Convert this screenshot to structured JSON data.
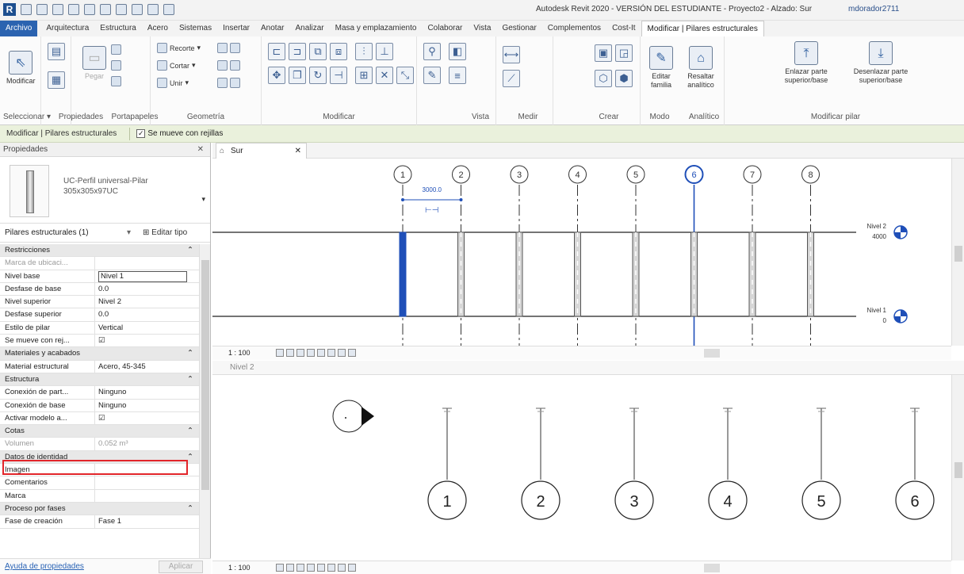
{
  "window_title": "Autodesk Revit 2020 - VERSIÓN DEL ESTUDIANTE - Proyecto2 - Alzado: Sur",
  "user": "mdorador2711",
  "tabs": [
    "Archivo",
    "Arquitectura",
    "Estructura",
    "Acero",
    "Sistemas",
    "Insertar",
    "Anotar",
    "Analizar",
    "Masa y emplazamiento",
    "Colaborar",
    "Vista",
    "Gestionar",
    "Complementos",
    "Cost-It",
    "Modificar | Pilares estructurales"
  ],
  "ribbon": {
    "modificar_label": "Modificar",
    "pegar_label": "Pegar",
    "recorte_label": "Recorte",
    "cortar_label": "Cortar",
    "unir_label": "Unir",
    "editar_familia_label": "Editar familia",
    "resaltar_analitico_label": "Resaltar analítico",
    "enlazar_label": "Enlazar parte superior/base",
    "desenlazar_label": "Desenlazar parte superior/base",
    "panels": {
      "seleccionar": "Seleccionar ▾",
      "propiedades": "Propiedades",
      "portapapeles": "Portapapeles",
      "geometria": "Geometría",
      "modificar": "Modificar",
      "vista": "Vista",
      "medir": "Medir",
      "crear": "Crear",
      "modo": "Modo",
      "analitico": "Analítico",
      "modificar_pilar": "Modificar pilar"
    }
  },
  "context_bar": {
    "label": "Modificar | Pilares estructurales",
    "checkbox_label": "Se mueve con rejillas",
    "checked": true
  },
  "properties": {
    "title": "Propiedades",
    "type_name": "UC-Perfil universal-Pilar 305x305x97UC",
    "filter": "Pilares estructurales (1)",
    "edit_type": "Editar tipo",
    "rows": [
      {
        "group": "Restricciones"
      },
      {
        "k": "Marca de ubicaci...",
        "v": "",
        "ro": true
      },
      {
        "k": "Nivel base",
        "v": "Nivel 1",
        "box": true
      },
      {
        "k": "Desfase de base",
        "v": "0.0"
      },
      {
        "k": "Nivel superior",
        "v": "Nivel 2"
      },
      {
        "k": "Desfase superior",
        "v": "0.0"
      },
      {
        "k": "Estilo de pilar",
        "v": "Vertical"
      },
      {
        "k": "Se mueve con rej...",
        "v": "☑"
      },
      {
        "group": "Materiales y acabados"
      },
      {
        "k": "Material estructural",
        "v": "Acero, 45-345"
      },
      {
        "group": "Estructura"
      },
      {
        "k": "Conexión de part...",
        "v": "Ninguno"
      },
      {
        "k": "Conexión de base",
        "v": "Ninguno"
      },
      {
        "k": "Activar modelo a...",
        "v": "☑"
      },
      {
        "group": "Cotas"
      },
      {
        "k": "Volumen",
        "v": "0.052 m³",
        "ro": true
      },
      {
        "group": "Datos de identidad"
      },
      {
        "k": "Imagen",
        "v": ""
      },
      {
        "k": "Comentarios",
        "v": ""
      },
      {
        "k": "Marca",
        "v": ""
      },
      {
        "group": "Proceso por fases"
      },
      {
        "k": "Fase de creación",
        "v": "Fase 1"
      }
    ],
    "help_link": "Ayuda de propiedades",
    "apply": "Aplicar"
  },
  "view1": {
    "tab_label": "Sur",
    "grids": [
      "1",
      "2",
      "3",
      "4",
      "5",
      "6",
      "7",
      "8"
    ],
    "selected_grid": "6",
    "dimension": "3000.0",
    "levels": [
      {
        "name": "Nivel 2",
        "value": "4000"
      },
      {
        "name": "Nivel 1",
        "value": "0"
      }
    ],
    "scale": "1 : 100"
  },
  "view2": {
    "title": "Nivel 2",
    "grids": [
      "1",
      "2",
      "3",
      "4",
      "5",
      "6"
    ],
    "scale": "1 : 100"
  },
  "colors": {
    "accent": "#2b63b0",
    "selection": "#1f4fb8",
    "highlight_box": "#e2252a",
    "context_bar": "#eaf1dc"
  }
}
